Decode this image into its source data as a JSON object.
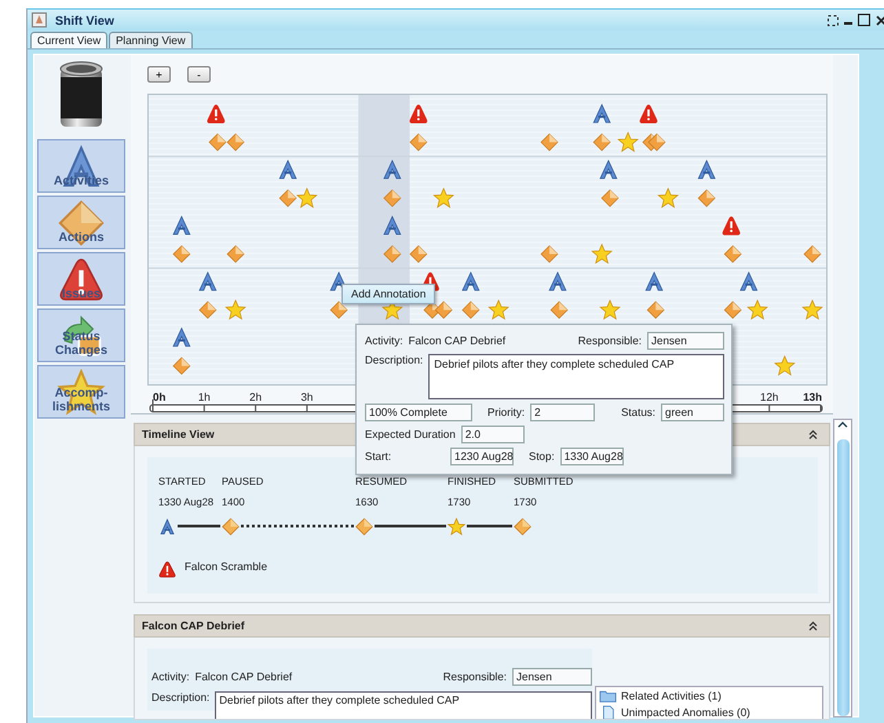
{
  "window": {
    "title": "Shift View"
  },
  "tabs": [
    {
      "label": "Current View",
      "selected": true
    },
    {
      "label": "Planning View",
      "selected": false
    }
  ],
  "sidebar": {
    "items": [
      {
        "label": "Activities",
        "kind": "activity"
      },
      {
        "label": "Actions",
        "kind": "action"
      },
      {
        "label": "Issues",
        "kind": "issue"
      },
      {
        "label": "Status Changes",
        "kind": "status"
      },
      {
        "label": "Accomp-lishments",
        "kind": "accomplishment"
      }
    ]
  },
  "zoom_buttons": [
    "+",
    "-"
  ],
  "canvas": {
    "groups": [
      {
        "lanes": [
          {
            "markers": [
              {
                "kind": "issue"
              },
              {
                "kind": "issue"
              },
              {
                "kind": "activity"
              },
              {
                "kind": "issue"
              }
            ]
          },
          {
            "markers": [
              {
                "kind": "action"
              },
              {
                "kind": "action"
              },
              {
                "kind": "action"
              },
              {
                "kind": "action"
              },
              {
                "kind": "action"
              },
              {
                "kind": "accomplishment"
              },
              {
                "kind": "action"
              },
              {
                "kind": "action"
              }
            ]
          }
        ]
      },
      {
        "lanes": [
          {
            "markers": [
              {
                "kind": "activity"
              },
              {
                "kind": "activity"
              },
              {
                "kind": "activity"
              },
              {
                "kind": "activity"
              }
            ]
          },
          {
            "markers": [
              {
                "kind": "action"
              },
              {
                "kind": "accomplishment"
              },
              {
                "kind": "action"
              },
              {
                "kind": "accomplishment"
              },
              {
                "kind": "action"
              },
              {
                "kind": "accomplishment"
              },
              {
                "kind": "action"
              }
            ]
          },
          {
            "markers": [
              {
                "kind": "activity"
              },
              {
                "kind": "activity"
              },
              {
                "kind": "issue"
              }
            ]
          },
          {
            "markers": [
              {
                "kind": "action"
              },
              {
                "kind": "action"
              },
              {
                "kind": "action"
              },
              {
                "kind": "action"
              },
              {
                "kind": "action"
              },
              {
                "kind": "accomplishment"
              },
              {
                "kind": "action"
              },
              {
                "kind": "action"
              }
            ]
          }
        ]
      },
      {
        "lanes": [
          {
            "markers": [
              {
                "kind": "activity"
              },
              {
                "kind": "activity"
              },
              {
                "kind": "issue"
              },
              {
                "kind": "activity"
              },
              {
                "kind": "activity"
              },
              {
                "kind": "activity"
              },
              {
                "kind": "activity"
              }
            ]
          },
          {
            "markers": [
              {
                "kind": "action"
              },
              {
                "kind": "accomplishment"
              },
              {
                "kind": "action"
              },
              {
                "kind": "accomplishment"
              },
              {
                "kind": "action"
              },
              {
                "kind": "action"
              },
              {
                "kind": "action"
              },
              {
                "kind": "accomplishment"
              },
              {
                "kind": "action"
              },
              {
                "kind": "accomplishment"
              },
              {
                "kind": "action"
              },
              {
                "kind": "action"
              },
              {
                "kind": "accomplishment"
              },
              {
                "kind": "accomplishment"
              }
            ]
          },
          {
            "markers": [
              {
                "kind": "activity"
              }
            ]
          },
          {
            "markers": [
              {
                "kind": "action"
              },
              {
                "kind": "accomplishment"
              }
            ]
          }
        ]
      }
    ],
    "axis": {
      "labels": [
        "0h",
        "1h",
        "2h",
        "3h",
        "12h",
        "13h"
      ]
    }
  },
  "context_menu": {
    "items": [
      "Add Annotation"
    ]
  },
  "popup": {
    "activity_label": "Activity:",
    "activity": "Falcon CAP Debrief",
    "responsible_label": "Responsible:",
    "responsible": "Jensen",
    "description_label": "Description:",
    "description": "Debrief pilots after they complete scheduled CAP",
    "progress": "100% Complete",
    "priority_label": "Priority:",
    "priority": "2",
    "status_label": "Status:",
    "status": "green",
    "duration_label": "Expected Duration",
    "duration": "2.0",
    "start_label": "Start:",
    "start": "1230 Aug28",
    "stop_label": "Stop:",
    "stop": "1330 Aug28"
  },
  "timeline_view": {
    "title": "Timeline View",
    "events": [
      {
        "label": "STARTED",
        "time": "1330 Aug28",
        "kind": "activity",
        "dashed_link_after": false
      },
      {
        "label": "PAUSED",
        "time": "1400",
        "kind": "action",
        "dashed_link_after": true
      },
      {
        "label": "RESUMED",
        "time": "1630",
        "kind": "action",
        "dashed_link_after": false
      },
      {
        "label": "FINISHED",
        "time": "1730",
        "kind": "accomplishment",
        "dashed_link_after": false
      },
      {
        "label": "SUBMITTED",
        "time": "1730",
        "kind": "action"
      }
    ],
    "issues": [
      {
        "label": "Falcon Scramble"
      }
    ]
  },
  "detail_panel": {
    "title": "Falcon CAP Debrief",
    "activity_label": "Activity:",
    "activity": "Falcon CAP Debrief",
    "responsible_label": "Responsible:",
    "responsible": "Jensen",
    "description_label": "Description:",
    "description": "Debrief pilots after they complete scheduled CAP",
    "related": [
      {
        "label": "Related Activities (1)",
        "kind": "folder"
      },
      {
        "label": "Unimpacted Anomalies (0)",
        "kind": "document"
      }
    ]
  }
}
